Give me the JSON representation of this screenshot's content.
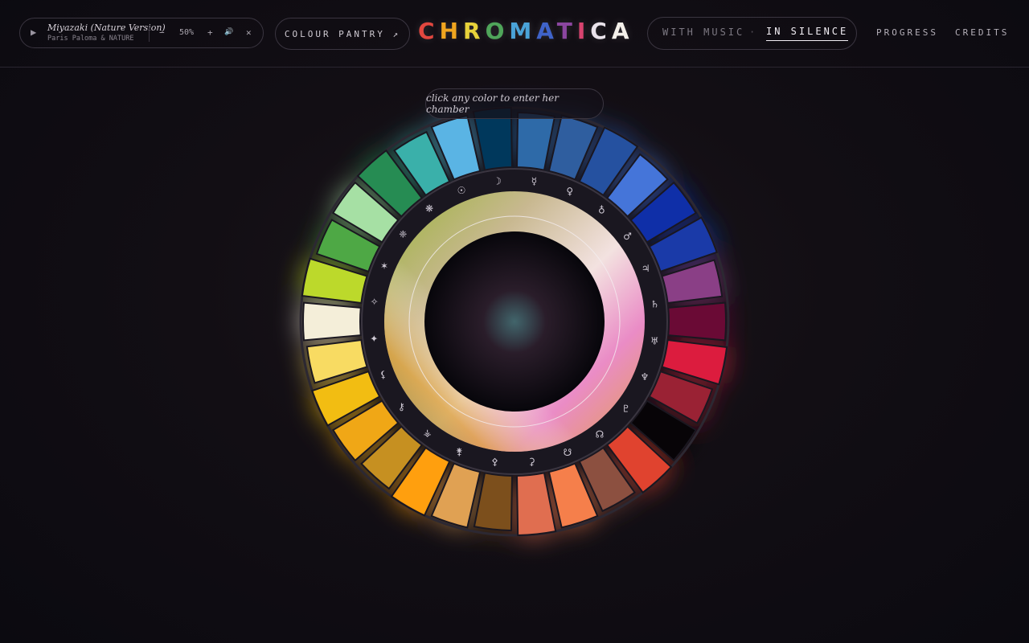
{
  "player": {
    "title": "Miyazaki (Nature Version)",
    "artist": "Paris Paloma & NATURE",
    "play_icon": "▶",
    "minus": "−",
    "volume": "50%",
    "plus": "+",
    "speaker_icon": "🔊",
    "close_icon": "✕"
  },
  "pantry_label": "COLOUR PANTRY ↗",
  "logo": {
    "letters": [
      "C",
      "H",
      "R",
      "O",
      "M",
      "A",
      "T",
      "I",
      "C",
      "A"
    ],
    "colors": [
      "#e2473f",
      "#f0a51f",
      "#e8d23a",
      "#4fa55a",
      "#4aa3d8",
      "#3f63c9",
      "#8b46a0",
      "#d8436f",
      "#e9e2ea",
      "#f4f0ea"
    ]
  },
  "mode": {
    "with_music": "WITH MUSIC",
    "separator": "·",
    "in_silence": "IN SILENCE",
    "active": "in_silence"
  },
  "nav": {
    "progress": "PROGRESS",
    "credits": "CREDITS"
  },
  "hint": "click any color to enter her chamber",
  "wheel": {
    "colors": [
      "#00385c",
      "#2e6aa8",
      "#2f5e9f",
      "#2551a0",
      "#4575d9",
      "#0f2fa8",
      "#1a3aa8",
      "#8a3f86",
      "#6a0a35",
      "#dc1c3e",
      "#9a2234",
      "#070407",
      "#e0432f",
      "#8c5040",
      "#f57f4b",
      "#e06e50",
      "#7c4f1c",
      "#e0a153",
      "#ff9f0e",
      "#c69021",
      "#f0a716",
      "#f2bd12",
      "#f8db62",
      "#f4eed9",
      "#bcd92b",
      "#4ea845",
      "#a6e0a4",
      "#268c53",
      "#3ab0aa",
      "#5ab4e4"
    ],
    "symbols": [
      "☿",
      "♀",
      "♁",
      "♂",
      "♃",
      "♄",
      "♅",
      "♆",
      "♇",
      "☊",
      "☋",
      "⚳",
      "⚴",
      "⚵",
      "⚶",
      "⚷",
      "⚸",
      "✦",
      "✧",
      "✶",
      "❈",
      "❋",
      "☉",
      "☽"
    ]
  }
}
